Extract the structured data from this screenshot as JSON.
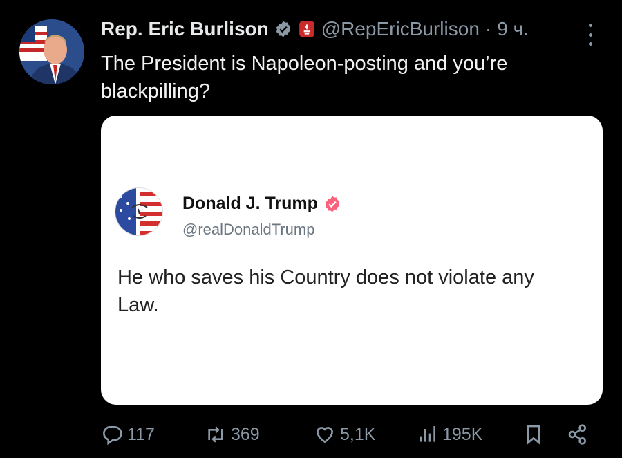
{
  "author": {
    "name": "Rep. Eric Burlison",
    "handle": "@RepEricBurlison",
    "separator": "·",
    "time": "9 ч."
  },
  "tweet_text": "The President is Napoleon-posting and you’re blackpilling?",
  "quoted": {
    "name": "Donald J. Trump",
    "handle": "@realDonaldTrump",
    "text": "He who saves his Country does not violate any Law."
  },
  "actions": {
    "replies": "117",
    "retweets": "369",
    "likes": "5,1K",
    "views": "195K"
  },
  "colors": {
    "background": "#000000",
    "muted": "#8b98a5",
    "verified_blue": "#8b98a5",
    "verified_pink": "#f9617d",
    "gov_badge": "#c92a2a"
  },
  "icons": [
    "verified-icon",
    "government-badge-icon",
    "more-icon",
    "reply-icon",
    "retweet-icon",
    "like-icon",
    "views-icon",
    "bookmark-icon",
    "share-icon"
  ]
}
